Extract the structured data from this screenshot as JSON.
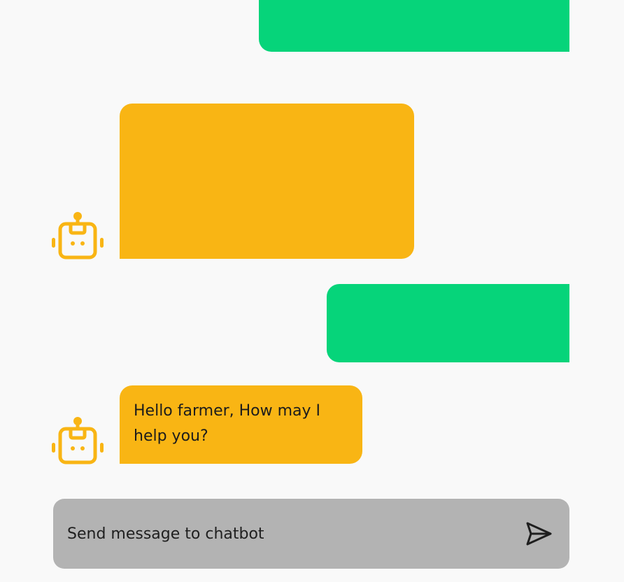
{
  "colors": {
    "background": "#f9f9f9",
    "user_bubble": "#06d47a",
    "bot_bubble": "#f9b514",
    "composer": "#b3b3b3",
    "text": "#1c1c1c"
  },
  "messages": [
    {
      "sender": "user",
      "text": ""
    },
    {
      "sender": "bot",
      "text": ""
    },
    {
      "sender": "user",
      "text": ""
    },
    {
      "sender": "bot",
      "text": "Hello farmer, How may I help you?"
    }
  ],
  "icons": {
    "bot_avatar": "robot-icon",
    "send": "send-icon"
  },
  "composer": {
    "placeholder": "Send message to chatbot",
    "value": ""
  }
}
